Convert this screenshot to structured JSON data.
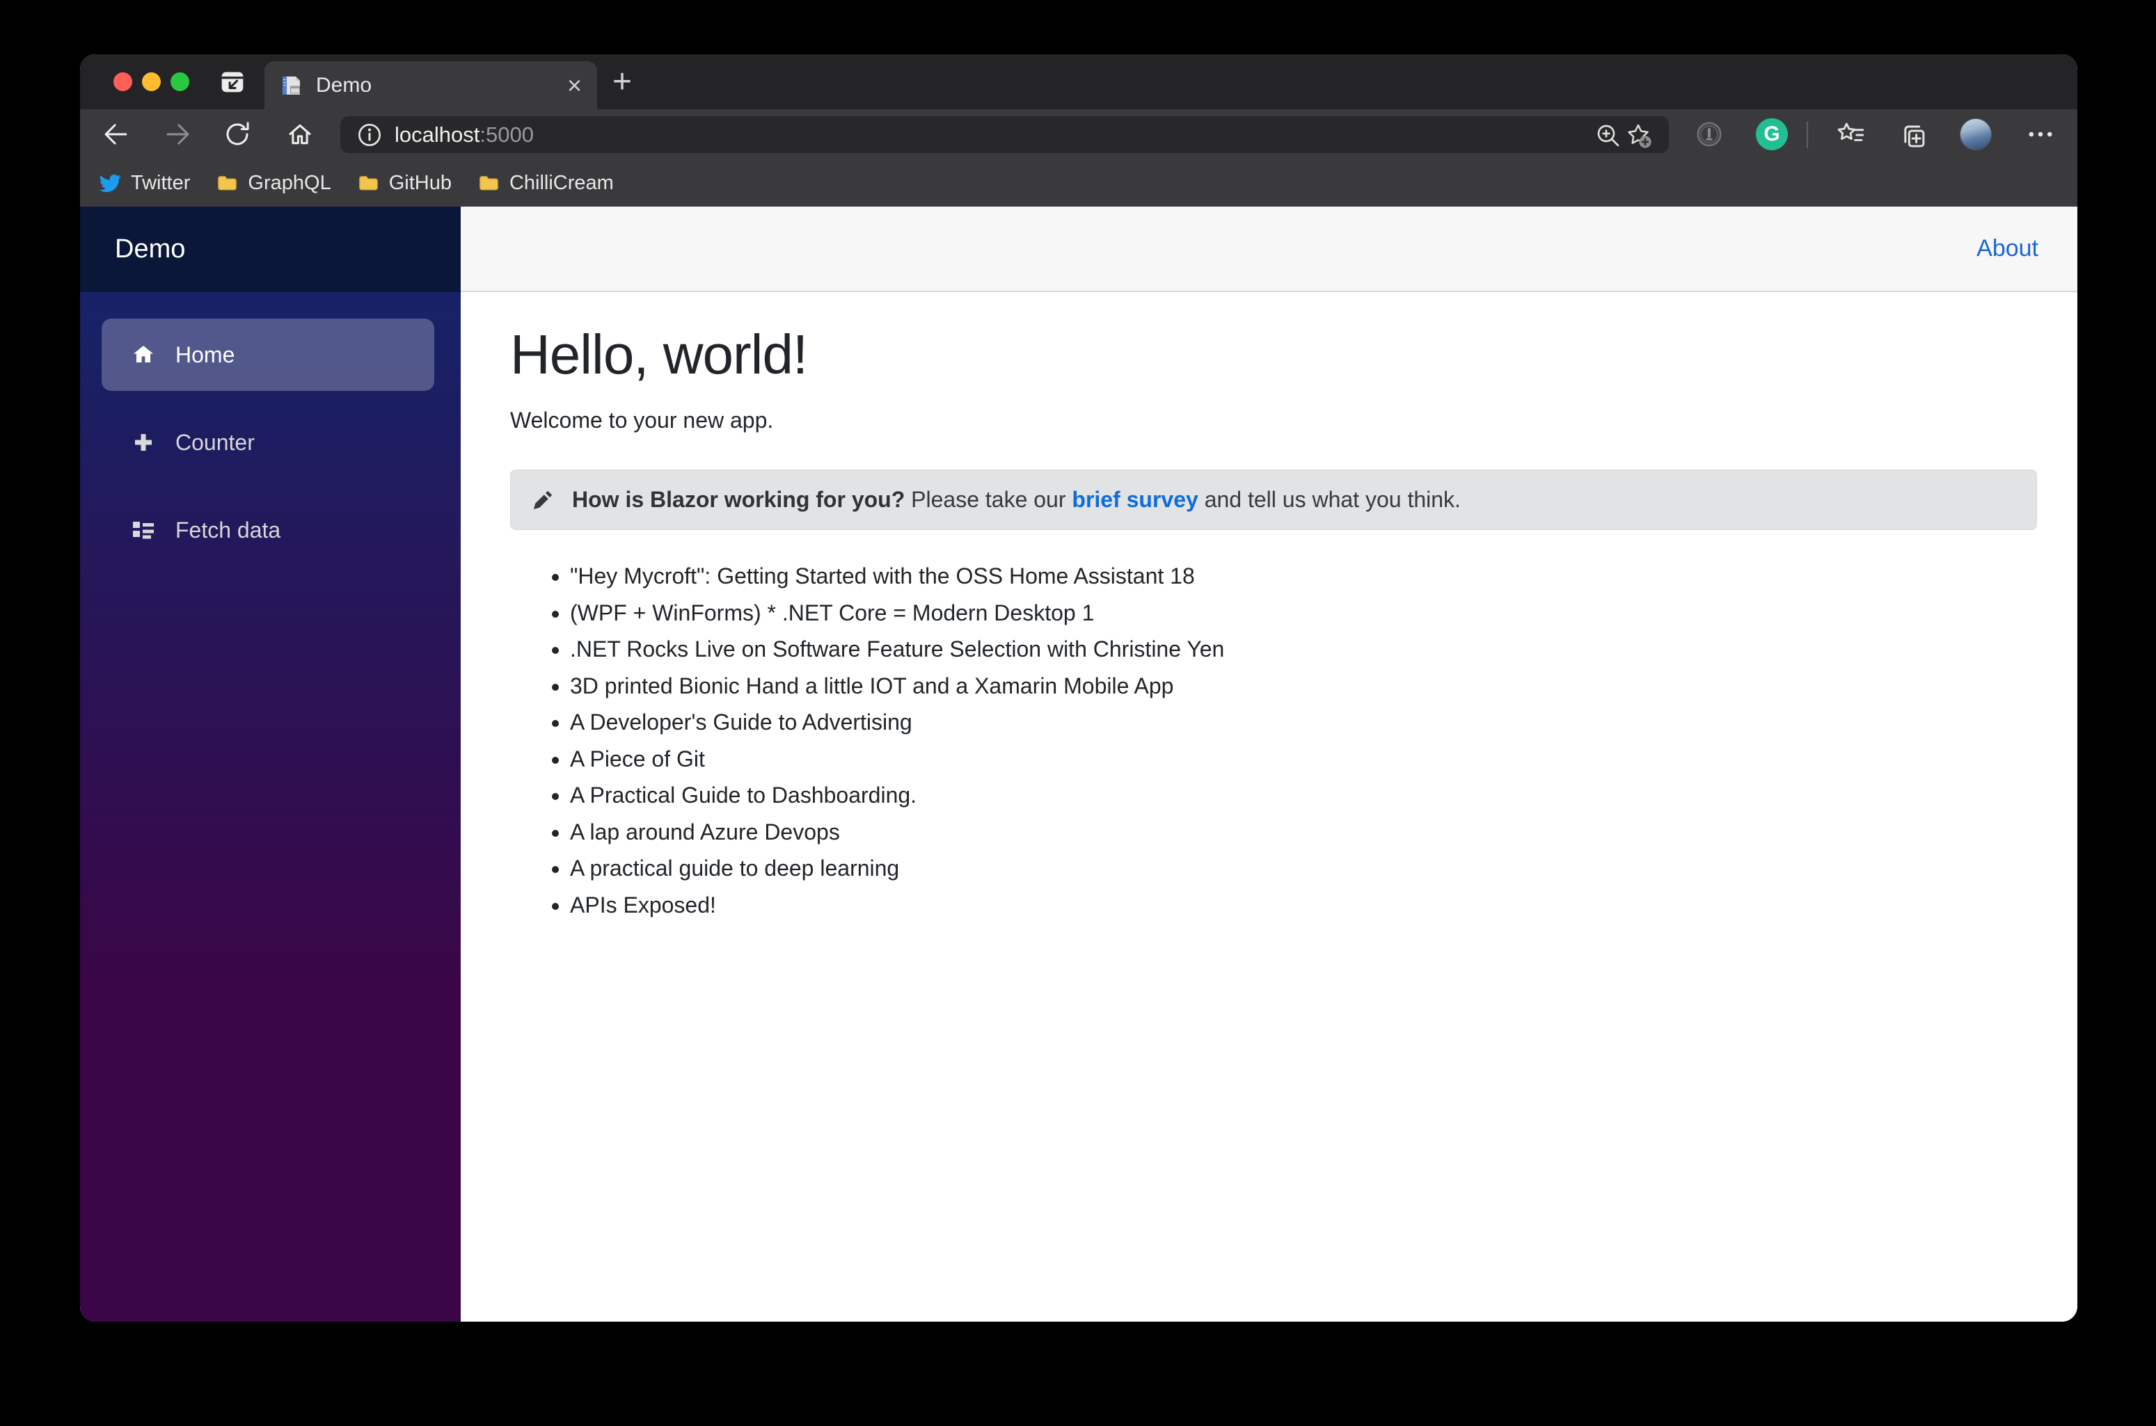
{
  "browser": {
    "tab": {
      "title": "Demo"
    },
    "address_bar": {
      "host": "localhost",
      "port": ":5000"
    },
    "bookmarks": [
      {
        "label": "Twitter"
      },
      {
        "label": "GraphQL"
      },
      {
        "label": "GitHub"
      },
      {
        "label": "ChilliCream"
      }
    ],
    "grammarly_initial": "G"
  },
  "app": {
    "sidebar": {
      "brand": "Demo",
      "items": [
        {
          "label": "Home",
          "active": true
        },
        {
          "label": "Counter",
          "active": false
        },
        {
          "label": "Fetch data",
          "active": false
        }
      ]
    },
    "topbar": {
      "about": "About"
    },
    "main": {
      "heading": "Hello, world!",
      "welcome": "Welcome to your new app.",
      "alert": {
        "bold": "How is Blazor working for you?",
        "before_link": " Please take our ",
        "link": "brief survey",
        "after_link": " and tell us what you think."
      },
      "list_items": [
        "\"Hey Mycroft\": Getting Started with the OSS Home Assistant 18",
        "(WPF + WinForms) * .NET Core = Modern Desktop 1",
        ".NET Rocks Live on Software Feature Selection with Christine Yen",
        "3D printed Bionic Hand a little IOT and a Xamarin Mobile App",
        "A Developer's Guide to Advertising",
        "A Piece of Git",
        "A Practical Guide to Dashboarding.",
        "A lap around Azure Devops",
        "A practical guide to deep learning",
        "APIs Exposed!"
      ]
    }
  },
  "colors": {
    "accent_blue": "#1b66d1",
    "link_blue": "#0d6ed9",
    "sidebar_top": "#12266b",
    "sidebar_bottom": "#3a0647",
    "grammarly_green": "#21bf92",
    "twitter_blue": "#1d9bf0"
  }
}
